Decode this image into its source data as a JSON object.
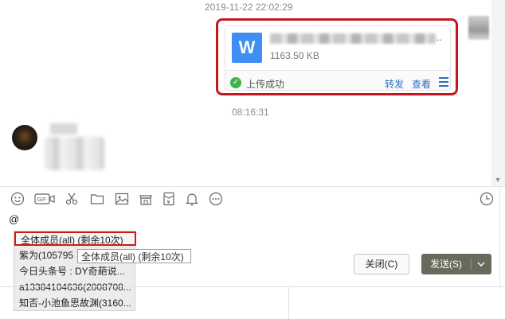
{
  "chat": {
    "timestamp_top": "2019-11-22 22:02:29",
    "timestamp_mid": "08:16:31"
  },
  "file_card": {
    "dots": "..",
    "size": "1163.50 KB",
    "icon_letter": "W",
    "status": "上传成功",
    "forward_label": "转发",
    "view_label": "查看"
  },
  "composer": {
    "text": "@"
  },
  "mention_list": {
    "items": [
      "全体成员(all) (剩余10次)",
      "紫为(105795",
      "今日头条号 : DY奇葩说...",
      "a13384104636(2008708...",
      "知否-小池鱼思故渊(3160..."
    ]
  },
  "tooltip": {
    "text": "全体成员(all) (剩余10次)"
  },
  "buttons": {
    "close_label": "关闭(C)",
    "send_label": "发送(S)"
  },
  "colors": {
    "highlight_red": "#c5171c",
    "link_blue": "#2b6fc2",
    "word_blue": "#3f8ef2",
    "send_bg": "#6a6a5c",
    "success_green": "#3cb44b"
  }
}
